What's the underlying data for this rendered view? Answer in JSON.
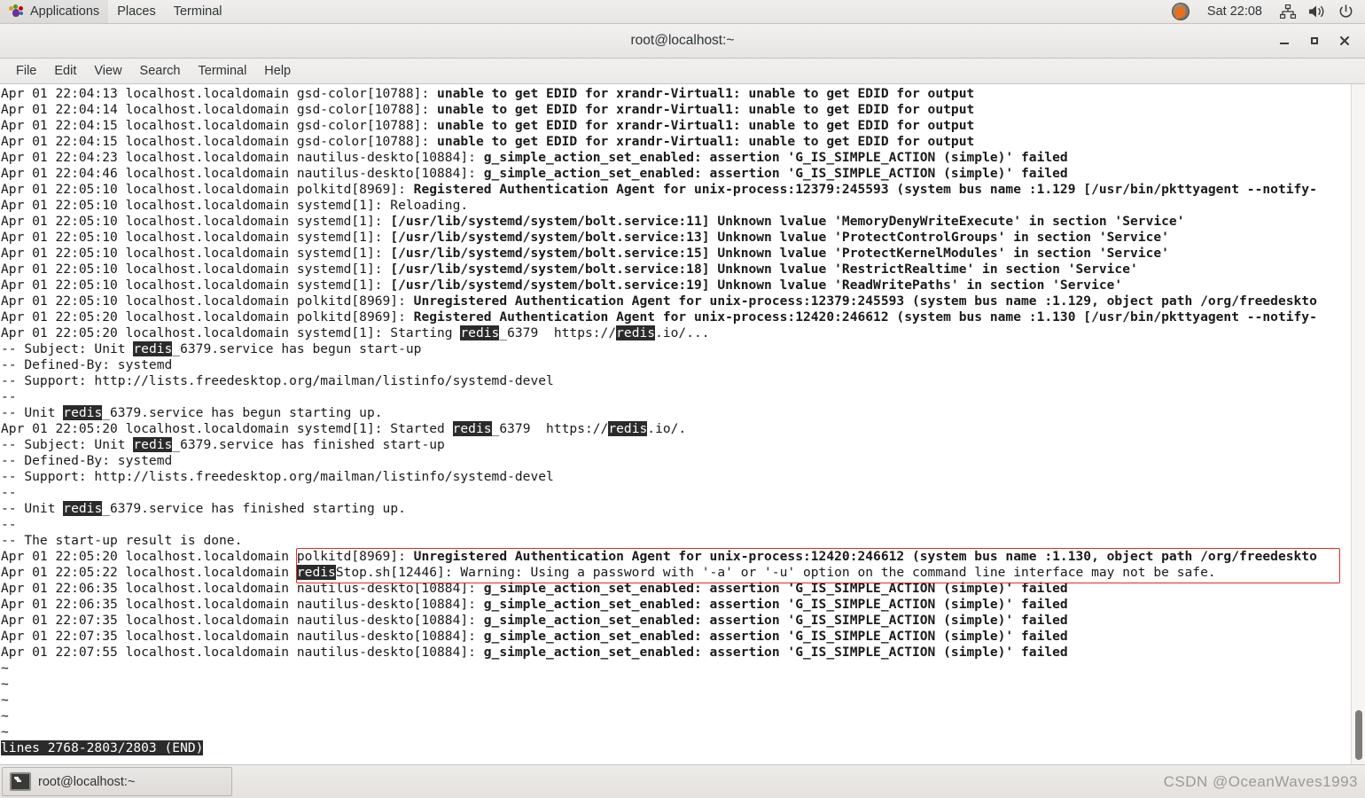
{
  "top_panel": {
    "menus": [
      "Applications",
      "Places",
      "Terminal"
    ],
    "foot_icon": "gnome-foot-icon",
    "tray": {
      "app_icon": "flame-app-icon",
      "clock": "Sat 22:08",
      "network_icon": "network-icon",
      "volume_icon": "volume-icon",
      "power_icon": "power-icon"
    }
  },
  "window": {
    "title": "root@localhost:~",
    "controls": {
      "minimize": "minimize-icon",
      "maximize": "maximize-icon",
      "close": "close-icon"
    },
    "menubar": [
      "File",
      "Edit",
      "View",
      "Search",
      "Terminal",
      "Help"
    ]
  },
  "terminal": {
    "lines": [
      [
        {
          "t": "Apr 01 22:04:13 localhost.localdomain gsd-color[10788]: "
        },
        {
          "t": "unable to get EDID for xrandr-Virtual1: unable to get EDID for output",
          "b": true
        }
      ],
      [
        {
          "t": "Apr 01 22:04:14 localhost.localdomain gsd-color[10788]: "
        },
        {
          "t": "unable to get EDID for xrandr-Virtual1: unable to get EDID for output",
          "b": true
        }
      ],
      [
        {
          "t": "Apr 01 22:04:15 localhost.localdomain gsd-color[10788]: "
        },
        {
          "t": "unable to get EDID for xrandr-Virtual1: unable to get EDID for output",
          "b": true
        }
      ],
      [
        {
          "t": "Apr 01 22:04:15 localhost.localdomain gsd-color[10788]: "
        },
        {
          "t": "unable to get EDID for xrandr-Virtual1: unable to get EDID for output",
          "b": true
        }
      ],
      [
        {
          "t": "Apr 01 22:04:23 localhost.localdomain nautilus-deskto[10884]: "
        },
        {
          "t": "g_simple_action_set_enabled: assertion 'G_IS_SIMPLE_ACTION (simple)' failed",
          "b": true
        }
      ],
      [
        {
          "t": "Apr 01 22:04:46 localhost.localdomain nautilus-deskto[10884]: "
        },
        {
          "t": "g_simple_action_set_enabled: assertion 'G_IS_SIMPLE_ACTION (simple)' failed",
          "b": true
        }
      ],
      [
        {
          "t": "Apr 01 22:05:10 localhost.localdomain polkitd[8969]: "
        },
        {
          "t": "Registered Authentication Agent for unix-process:12379:245593 (system bus name :1.129 [/usr/bin/pkttyagent --notify-",
          "b": true
        }
      ],
      [
        {
          "t": "Apr 01 22:05:10 localhost.localdomain systemd[1]: Reloading."
        }
      ],
      [
        {
          "t": "Apr 01 22:05:10 localhost.localdomain systemd[1]: "
        },
        {
          "t": "[/usr/lib/systemd/system/bolt.service:11] Unknown lvalue 'MemoryDenyWriteExecute' in section 'Service'",
          "b": true
        }
      ],
      [
        {
          "t": "Apr 01 22:05:10 localhost.localdomain systemd[1]: "
        },
        {
          "t": "[/usr/lib/systemd/system/bolt.service:13] Unknown lvalue 'ProtectControlGroups' in section 'Service'",
          "b": true
        }
      ],
      [
        {
          "t": "Apr 01 22:05:10 localhost.localdomain systemd[1]: "
        },
        {
          "t": "[/usr/lib/systemd/system/bolt.service:15] Unknown lvalue 'ProtectKernelModules' in section 'Service'",
          "b": true
        }
      ],
      [
        {
          "t": "Apr 01 22:05:10 localhost.localdomain systemd[1]: "
        },
        {
          "t": "[/usr/lib/systemd/system/bolt.service:18] Unknown lvalue 'RestrictRealtime' in section 'Service'",
          "b": true
        }
      ],
      [
        {
          "t": "Apr 01 22:05:10 localhost.localdomain systemd[1]: "
        },
        {
          "t": "[/usr/lib/systemd/system/bolt.service:19] Unknown lvalue 'ReadWritePaths' in section 'Service'",
          "b": true
        }
      ],
      [
        {
          "t": "Apr 01 22:05:10 localhost.localdomain polkitd[8969]: "
        },
        {
          "t": "Unregistered Authentication Agent for unix-process:12379:245593 (system bus name :1.129, object path /org/freedeskto",
          "b": true
        }
      ],
      [
        {
          "t": "Apr 01 22:05:20 localhost.localdomain polkitd[8969]: "
        },
        {
          "t": "Registered Authentication Agent for unix-process:12420:246612 (system bus name :1.130 [/usr/bin/pkttyagent --notify-",
          "b": true
        }
      ],
      [
        {
          "t": "Apr 01 22:05:20 localhost.localdomain systemd[1]: Starting "
        },
        {
          "t": "redis",
          "h": true
        },
        {
          "t": "_6379  https://"
        },
        {
          "t": "redis",
          "h": true
        },
        {
          "t": ".io/..."
        }
      ],
      [
        {
          "t": "-- Subject: Unit "
        },
        {
          "t": "redis",
          "h": true
        },
        {
          "t": "_6379.service has begun start-up"
        }
      ],
      [
        {
          "t": "-- Defined-By: systemd"
        }
      ],
      [
        {
          "t": "-- Support: http://lists.freedesktop.org/mailman/listinfo/systemd-devel"
        }
      ],
      [
        {
          "t": "--"
        }
      ],
      [
        {
          "t": "-- Unit "
        },
        {
          "t": "redis",
          "h": true
        },
        {
          "t": "_6379.service has begun starting up."
        }
      ],
      [
        {
          "t": "Apr 01 22:05:20 localhost.localdomain systemd[1]: Started "
        },
        {
          "t": "redis",
          "h": true
        },
        {
          "t": "_6379  https://"
        },
        {
          "t": "redis",
          "h": true
        },
        {
          "t": ".io/."
        }
      ],
      [
        {
          "t": "-- Subject: Unit "
        },
        {
          "t": "redis",
          "h": true
        },
        {
          "t": "_6379.service has finished start-up"
        }
      ],
      [
        {
          "t": "-- Defined-By: systemd"
        }
      ],
      [
        {
          "t": "-- Support: http://lists.freedesktop.org/mailman/listinfo/systemd-devel"
        }
      ],
      [
        {
          "t": "--"
        }
      ],
      [
        {
          "t": "-- Unit "
        },
        {
          "t": "redis",
          "h": true
        },
        {
          "t": "_6379.service has finished starting up."
        }
      ],
      [
        {
          "t": "--"
        }
      ],
      [
        {
          "t": "-- The start-up result is done."
        }
      ],
      [
        {
          "t": "Apr 01 22:05:20 localhost.localdomain "
        },
        {
          "t": "polkitd[8969]: "
        },
        {
          "t": "Unregistered Authentication Agent for unix-process:12420:246612 (system bus name :1.130, object path /org/freedeskto",
          "b": true
        }
      ],
      [
        {
          "t": "Apr 01 22:05:22 localhost.localdomain "
        },
        {
          "t": "redis",
          "h": true
        },
        {
          "t": "Stop.sh[12446]: Warning: Using a password with '-a' or '-u' option on the command line interface may not be safe."
        }
      ],
      [
        {
          "t": "Apr 01 22:06:35 localhost.localdomain nautilus-deskto[10884]: "
        },
        {
          "t": "g_simple_action_set_enabled: assertion 'G_IS_SIMPLE_ACTION (simple)' failed",
          "b": true
        }
      ],
      [
        {
          "t": "Apr 01 22:06:35 localhost.localdomain nautilus-deskto[10884]: "
        },
        {
          "t": "g_simple_action_set_enabled: assertion 'G_IS_SIMPLE_ACTION (simple)' failed",
          "b": true
        }
      ],
      [
        {
          "t": "Apr 01 22:07:35 localhost.localdomain nautilus-deskto[10884]: "
        },
        {
          "t": "g_simple_action_set_enabled: assertion 'G_IS_SIMPLE_ACTION (simple)' failed",
          "b": true
        }
      ],
      [
        {
          "t": "Apr 01 22:07:35 localhost.localdomain nautilus-deskto[10884]: "
        },
        {
          "t": "g_simple_action_set_enabled: assertion 'G_IS_SIMPLE_ACTION (simple)' failed",
          "b": true
        }
      ],
      [
        {
          "t": "Apr 01 22:07:55 localhost.localdomain nautilus-deskto[10884]: "
        },
        {
          "t": "g_simple_action_set_enabled: assertion 'G_IS_SIMPLE_ACTION (simple)' failed",
          "b": true
        }
      ],
      [
        {
          "t": "~"
        }
      ],
      [
        {
          "t": "~"
        }
      ],
      [
        {
          "t": "~"
        }
      ],
      [
        {
          "t": "~"
        }
      ],
      [
        {
          "t": "~"
        }
      ],
      [
        {
          "t": "lines 2768-2803/2803 (END)",
          "s": true
        }
      ]
    ],
    "status_line": "lines 2768-2803/2803 (END)",
    "search_term": "redis",
    "highlight_bg": "#2b2b2b",
    "annotation_color": "#e22b2b"
  },
  "taskbar": {
    "window_button": "root@localhost:~",
    "window_icon": "terminal-icon",
    "watermark": "CSDN @OceanWaves1993"
  }
}
